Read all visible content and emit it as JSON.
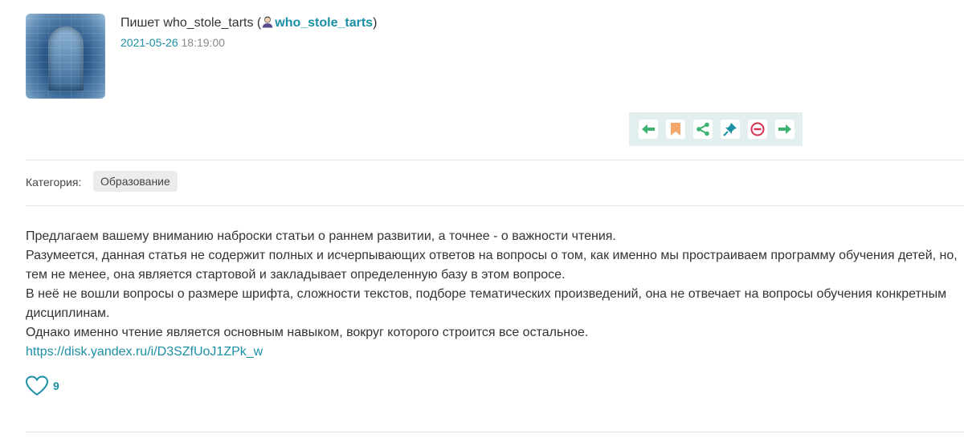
{
  "post": {
    "author_prefix": "Пишет who_stole_tarts (",
    "author_username": "who_stole_tarts",
    "author_suffix": ")",
    "date": "2021-05-26",
    "time": "18:19:00"
  },
  "toolbar": {
    "buttons": [
      {
        "name": "prev-arrow-icon",
        "color": "#3cb371"
      },
      {
        "name": "bookmark-icon",
        "color": "#f5a86a"
      },
      {
        "name": "share-icon",
        "color": "#3cb371"
      },
      {
        "name": "pin-icon",
        "color": "#1a8fa5"
      },
      {
        "name": "block-icon",
        "color": "#d9304f"
      },
      {
        "name": "next-arrow-icon",
        "color": "#3cb371"
      }
    ]
  },
  "category": {
    "label": "Категория:",
    "value": "Образование"
  },
  "body": {
    "paragraphs": [
      "Предлагаем вашему вниманию наброски статьи о раннем развитии, а точнее - о важности чтения.",
      "Разумеется, данная статья не содержит полных и исчерпывающих ответов на вопросы о том, как именно мы простраиваем программу обучения детей, но, тем не менее, она является стартовой и закладывает определенную базу в этом вопросе.",
      "В неё не вошли вопросы о размере шрифта, сложности текстов, подборе тематических произведений, она не отвечает на вопросы обучения конкретным дисциплинам.",
      "Однако именно чтение является основным навыком, вокруг которого строится все остальное."
    ],
    "link": "https://disk.yandex.ru/i/D3SZfUoJ1ZPk_w"
  },
  "likes": {
    "count": "9"
  },
  "colors": {
    "accent": "#1a8fa5",
    "toolbar_bg": "#e3eeee"
  }
}
